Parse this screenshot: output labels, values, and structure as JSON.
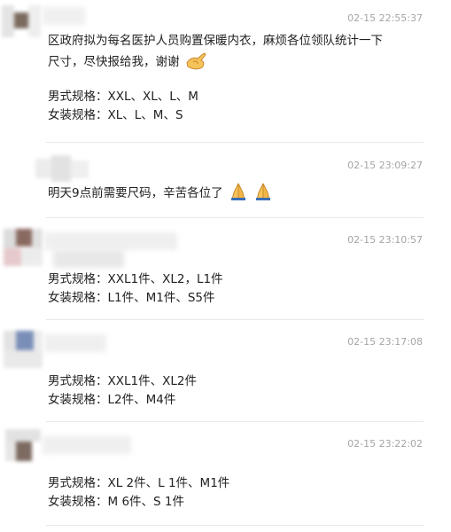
{
  "messages": [
    {
      "time": "02-15 22:55:37",
      "lines": [
        "区政府拟为每名医护人员购置保暖内衣，麻烦各位领队统计一下",
        "尺寸，尽快报给我，谢谢"
      ],
      "sizes": [
        "男式规格：XXL、XL、L、M",
        "女装规格：XL、L、M、S"
      ],
      "emoji": "ok-hand-icon"
    },
    {
      "time": "02-15 23:09:27",
      "lines": [
        "明天9点前需要尺码，辛苦各位了"
      ],
      "emoji": "praying-hands-icon"
    },
    {
      "time": "02-15 23:10:57",
      "lines": [
        "男式规格：XXL1件、XL2，L1件",
        "女装规格：L1件、M1件、S5件"
      ]
    },
    {
      "time": "02-15 23:17:08",
      "lines": [
        "男式规格：XXL1件、XL2件",
        "女装规格：L2件、M4件"
      ]
    },
    {
      "time": "02-15 23:22:02",
      "lines": [
        "男式规格：XL 2件、L 1件、M1件",
        "女装规格：M 6件、S 1件"
      ]
    }
  ],
  "colors": {
    "timestamp": "#a5a5a5",
    "separator": "#e8e8e8",
    "emoji_skin": "#f6c25a"
  }
}
